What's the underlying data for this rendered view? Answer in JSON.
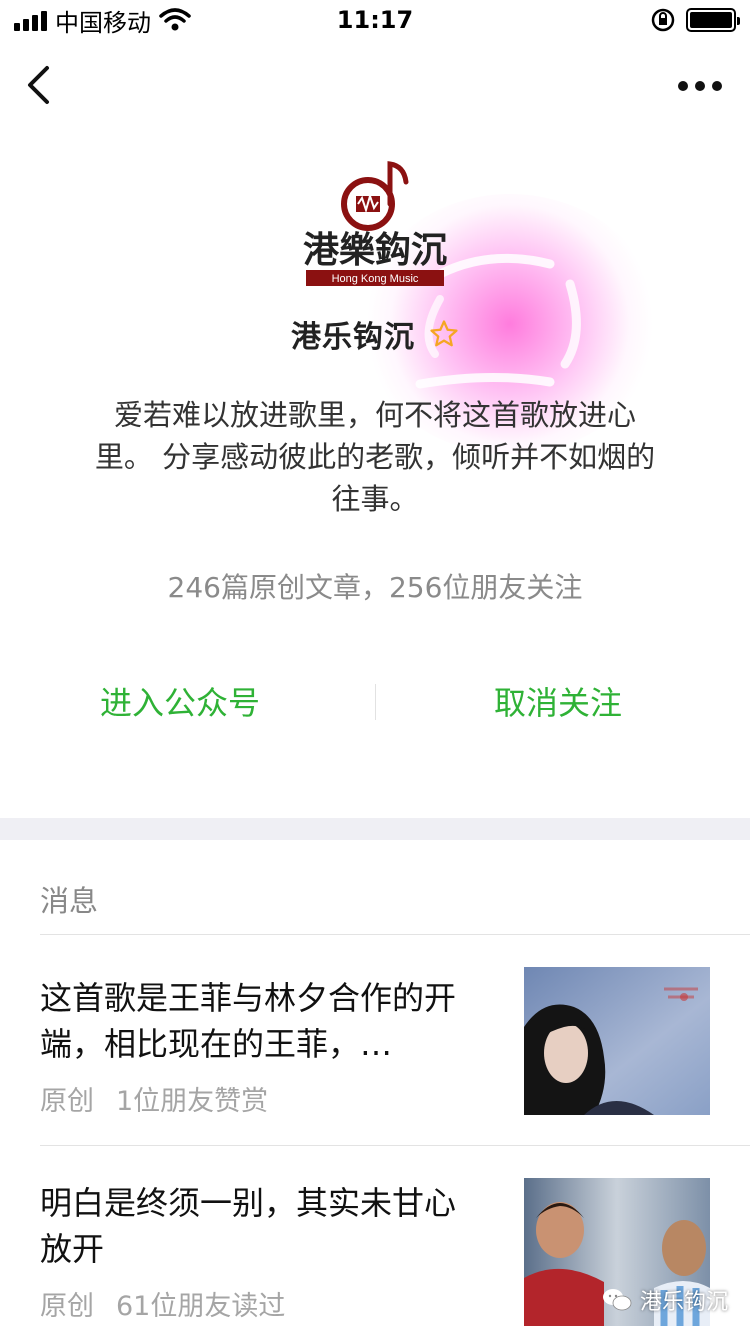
{
  "status_bar": {
    "carrier": "中国移动",
    "time": "11:17",
    "battery_level": 1.0
  },
  "nav": {
    "back_icon": "chevron-left-icon",
    "more_icon": "more-dots-icon"
  },
  "profile": {
    "name": "港乐钩沉",
    "logo_text": "港樂鈎沉",
    "logo_subtext": "Hong Kong Music",
    "description": "爱若难以放进歌里，何不将这首歌放进心里。 分享感动彼此的老歌，倾听并不如烟的往事。",
    "stats": "246篇原创文章，256位朋友关注",
    "enter_label": "进入公众号",
    "unfollow_label": "取消关注",
    "accent_color": "#2fb236",
    "star_icon": "star-outline-icon"
  },
  "messages": {
    "title": "消息",
    "articles": [
      {
        "title": "这首歌是王菲与林夕合作的开端，相比现在的王菲，…",
        "tag": "原创",
        "meta": "1位朋友赞赏"
      },
      {
        "title": "明白是终须一别，其实未甘心放开",
        "tag": "原创",
        "meta": "61位朋友读过"
      }
    ]
  },
  "watermark": {
    "text": "港乐钩沉",
    "icon": "wechat-icon"
  }
}
